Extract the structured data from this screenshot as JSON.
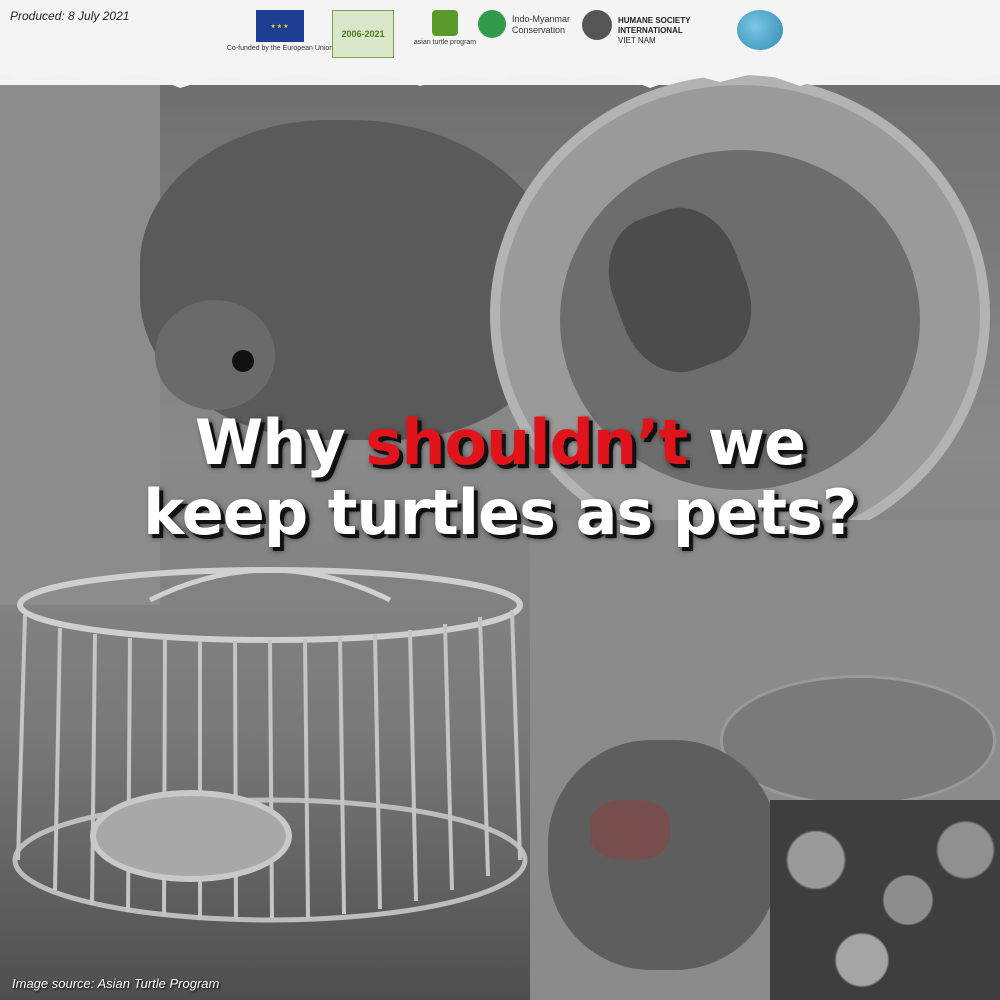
{
  "header": {
    "produced": "Produced: 8 July 2021",
    "logos": {
      "eu_caption": "Co-funded by the European Union",
      "badge_text": "2006-2021",
      "atp_caption": "asian turtle program",
      "imc_line1": "Indo-Myanmar",
      "imc_line2": "Conservation",
      "hsi_line1": "HUMANE SOCIETY",
      "hsi_line2": "INTERNATIONAL",
      "hsi_line3": "VIET NAM"
    }
  },
  "headline": {
    "part1": "Why ",
    "highlight": "shouldn’t",
    "part2": " we",
    "line2": "keep turtles as pets?"
  },
  "footer": {
    "source": "Image source: Asian Turtle Program"
  },
  "colors": {
    "highlight": "#e1141c",
    "headline": "#ffffff",
    "eu_blue": "#1c3f94"
  }
}
